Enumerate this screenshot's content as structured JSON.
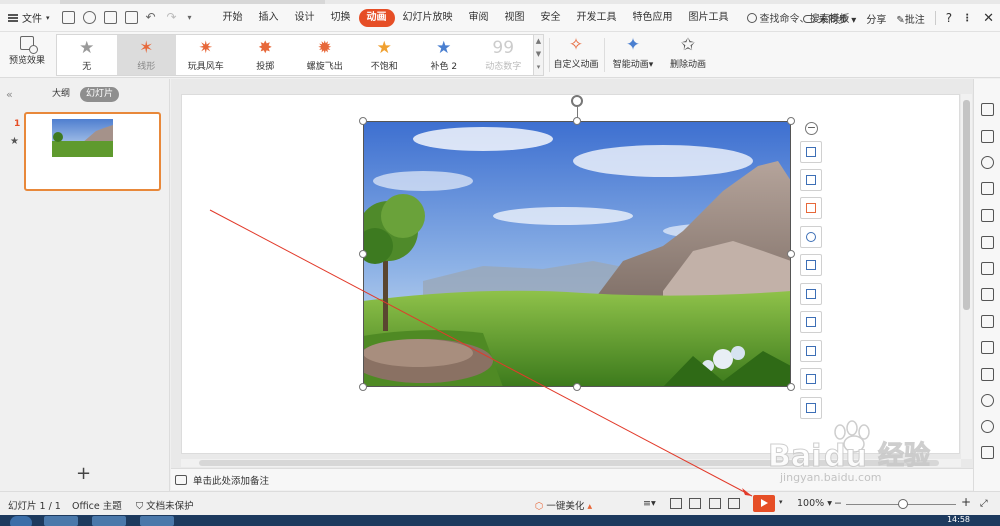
{
  "menubar": {
    "file_label": "文件",
    "tabs": [
      "开始",
      "插入",
      "设计",
      "切换",
      "动画",
      "幻灯片放映",
      "审阅",
      "视图",
      "安全",
      "开发工具",
      "特色应用",
      "图片工具"
    ],
    "active_tab": "动画",
    "search_placeholder": "查找命令、搜索模板",
    "sync_label": "未同步",
    "share_label": "分享",
    "comment_label": "批注",
    "help_label": "?",
    "more_label": "⋮",
    "close_label": "✕"
  },
  "ribbon": {
    "preview_label": "预览效果",
    "gallery": [
      {
        "label": "无",
        "icon": "none-star-icon",
        "glyph": "★",
        "color": "#9a9a9a"
      },
      {
        "label": "线形",
        "icon": "line-path-star-icon",
        "glyph": "✶",
        "color": "#e7683a"
      },
      {
        "label": "玩具风车",
        "icon": "pinwheel-icon",
        "glyph": "✷",
        "color": "#e7683a"
      },
      {
        "label": "投掷",
        "icon": "toss-icon",
        "glyph": "✸",
        "color": "#e7683a"
      },
      {
        "label": "螺旋飞出",
        "icon": "spiral-out-icon",
        "glyph": "✹",
        "color": "#e7683a"
      },
      {
        "label": "不饱和",
        "icon": "desaturate-star-icon",
        "glyph": "★",
        "color": "#f0a030"
      },
      {
        "label": "补色 2",
        "icon": "complement-star-icon",
        "glyph": "★",
        "color": "#4a7fd0"
      },
      {
        "label": "动态数字",
        "icon": "dynamic-number-icon",
        "glyph": "99",
        "color": "#cccccc"
      }
    ],
    "selected_index": 1,
    "custom_anim_label": "自定义动画",
    "smart_anim_label": "智能动画",
    "delete_anim_label": "删除动画"
  },
  "left_panel": {
    "outline_tab": "大纲",
    "slides_tab": "幻灯片",
    "slide_number": "1",
    "slide_anim_marker": "★"
  },
  "notes": {
    "placeholder": "单击此处添加备注"
  },
  "status": {
    "slide_info": "幻灯片 1 / 1",
    "theme": "Office 主题",
    "protection": "文档未保护",
    "beautify": "一键美化",
    "zoom": "100%",
    "zoom_minus": "−",
    "zoom_plus": "+"
  },
  "taskbar": {
    "clock": "14:58"
  },
  "watermark": {
    "brand": "Bai",
    "brand2": "du",
    "cn": "经验",
    "url": "jingyan.baidu.com"
  },
  "colors": {
    "accent": "#e64e26",
    "selection_border": "#e8883a"
  }
}
